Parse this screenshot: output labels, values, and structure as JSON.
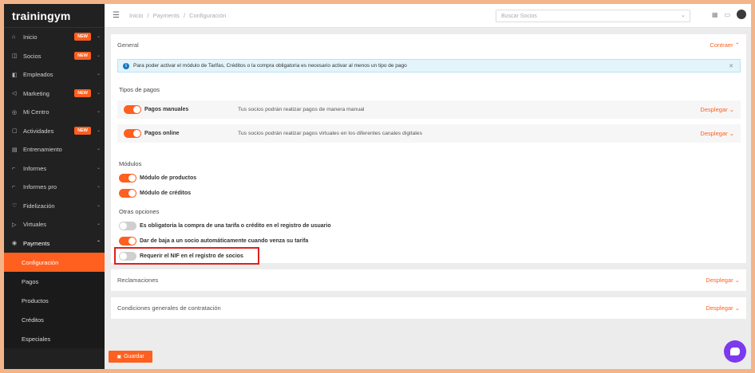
{
  "app": {
    "logo": "trainingym"
  },
  "sidebar": {
    "items": [
      {
        "icon": "⌂",
        "icon_name": "home-icon",
        "label": "Inicio",
        "badge": "NEW"
      },
      {
        "icon": "◫",
        "icon_name": "members-icon",
        "label": "Socios",
        "badge": "NEW"
      },
      {
        "icon": "◧",
        "icon_name": "employees-icon",
        "label": "Empleados",
        "badge": ""
      },
      {
        "icon": "◁",
        "icon_name": "marketing-icon",
        "label": "Marketing",
        "badge": "NEW"
      },
      {
        "icon": "◎",
        "icon_name": "location-icon",
        "label": "Mi Centro",
        "badge": ""
      },
      {
        "icon": "▢",
        "icon_name": "activities-icon",
        "label": "Actividades",
        "badge": "NEW"
      },
      {
        "icon": "▤",
        "icon_name": "training-icon",
        "label": "Entrenamiento",
        "badge": ""
      },
      {
        "icon": "⌐",
        "icon_name": "reports-icon",
        "label": "Informes",
        "badge": ""
      },
      {
        "icon": "⌐",
        "icon_name": "reports-pro-icon",
        "label": "Informes pro",
        "badge": ""
      },
      {
        "icon": "♡",
        "icon_name": "loyalty-icon",
        "label": "Fidelización",
        "badge": ""
      },
      {
        "icon": "▷",
        "icon_name": "virtual-icon",
        "label": "Virtuales",
        "badge": ""
      },
      {
        "icon": "◉",
        "icon_name": "payments-icon",
        "label": "Payments",
        "badge": ""
      }
    ],
    "payments_sub": [
      "Configuración",
      "Pagos",
      "Productos",
      "Créditos",
      "Especiales"
    ]
  },
  "topbar": {
    "breadcrumb": [
      "Inicio",
      "/",
      "Payments",
      "/",
      "Configuración"
    ],
    "search_placeholder": "Buscar Socios"
  },
  "general": {
    "title": "General",
    "collapse": "Contraer",
    "alert": "Para poder activar el módulo de Tarifas, Créditos o la compra obligatoria es necesario activar al menos un tipo de pago",
    "payment_types_title": "Tipos de pagos",
    "payment_types": [
      {
        "name": "Pagos manuales",
        "desc": "Tus socios podrán realizar pagos de manera manual",
        "expand": "Desplegar",
        "enabled": true
      },
      {
        "name": "Pagos online",
        "desc": "Tus socios podrán realizar pagos virtuales en los diferentes canales digitales",
        "expand": "Desplegar",
        "enabled": true
      }
    ],
    "modules_title": "Módulos",
    "modules": [
      {
        "label": "Módulo de productos",
        "enabled": true
      },
      {
        "label": "Módulo de créditos",
        "enabled": true
      }
    ],
    "other_title": "Otras opciones",
    "other_options": [
      {
        "label": "Es obligatoria la compra de una tarifa o crédito en el registro de usuario",
        "enabled": false
      },
      {
        "label": "Dar de baja a un socio automáticamente cuando venza su tarifa",
        "enabled": true
      },
      {
        "label": "Requerir el NIF en el registro de socios",
        "enabled": false
      }
    ]
  },
  "reclamaciones": {
    "title": "Reclamaciones",
    "expand": "Desplegar"
  },
  "condiciones": {
    "title": "Condiciones generales de contratación",
    "expand": "Desplegar"
  },
  "save_label": "Guardar",
  "colors": {
    "accent": "#ff5f1f",
    "sidebar": "#212121",
    "highlight": "#e02020",
    "chat": "#7c3aed"
  }
}
